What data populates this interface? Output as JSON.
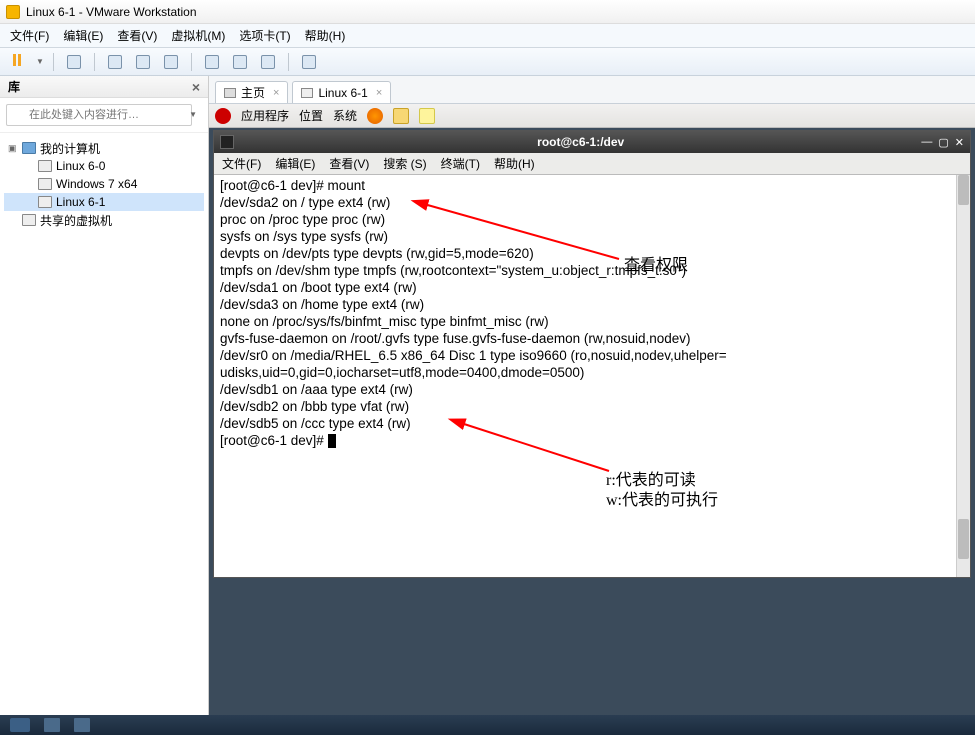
{
  "window": {
    "title": "Linux 6-1 - VMware Workstation"
  },
  "menubar": {
    "file": "文件(F)",
    "edit": "编辑(E)",
    "view": "查看(V)",
    "vm": "虚拟机(M)",
    "tabs": "选项卡(T)",
    "help": "帮助(H)"
  },
  "sidebar": {
    "title": "库",
    "search_placeholder": "在此处键入内容进行…",
    "root": "我的计算机",
    "items": [
      "Linux 6-0",
      "Windows 7 x64",
      "Linux 6-1"
    ],
    "shared": "共享的虚拟机"
  },
  "tabs": {
    "home": "主页",
    "vm": "Linux 6-1"
  },
  "gnome": {
    "apps": "应用程序",
    "places": "位置",
    "system": "系统"
  },
  "terminal": {
    "title": "root@c6-1:/dev",
    "menu": {
      "file": "文件(F)",
      "edit": "编辑(E)",
      "view": "查看(V)",
      "search": "搜索 (S)",
      "terminal": "终端(T)",
      "help": "帮助(H)"
    },
    "lines": [
      "[root@c6-1 dev]# mount",
      "/dev/sda2 on / type ext4 (rw)",
      "proc on /proc type proc (rw)",
      "sysfs on /sys type sysfs (rw)",
      "devpts on /dev/pts type devpts (rw,gid=5,mode=620)",
      "tmpfs on /dev/shm type tmpfs (rw,rootcontext=\"system_u:object_r:tmpfs_t:s0\")",
      "/dev/sda1 on /boot type ext4 (rw)",
      "/dev/sda3 on /home type ext4 (rw)",
      "none on /proc/sys/fs/binfmt_misc type binfmt_misc (rw)",
      "gvfs-fuse-daemon on /root/.gvfs type fuse.gvfs-fuse-daemon (rw,nosuid,nodev)",
      "/dev/sr0 on /media/RHEL_6.5 x86_64 Disc 1 type iso9660 (ro,nosuid,nodev,uhelper=",
      "udisks,uid=0,gid=0,iocharset=utf8,mode=0400,dmode=0500)",
      "/dev/sdb1 on /aaa type ext4 (rw)",
      "/dev/sdb2 on /bbb type vfat (rw)",
      "/dev/sdb5 on /ccc type ext4 (rw)",
      "[root@c6-1 dev]# "
    ]
  },
  "annotations": {
    "a1": "查看权限",
    "a2": "r:代表的可读",
    "a3": "w:代表的可执行"
  }
}
